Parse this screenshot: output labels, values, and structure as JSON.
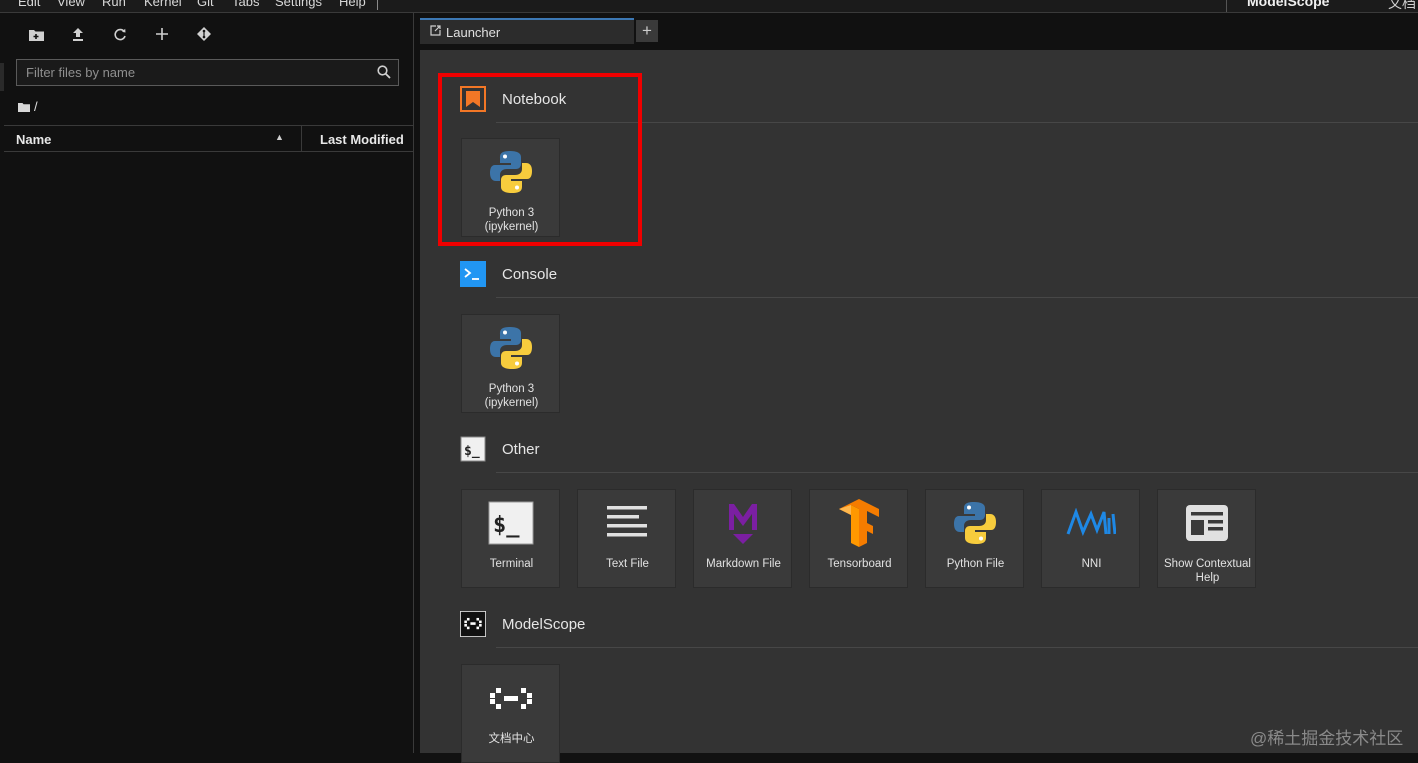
{
  "menubar": {
    "items": [
      "Edit",
      "View",
      "Run",
      "Kernel",
      "Git",
      "Tabs",
      "Settings",
      "Help"
    ],
    "brand": "ModelScope",
    "brand_doc": "文档"
  },
  "filebrowser": {
    "toolbar_icons": [
      "new-folder-icon",
      "upload-icon",
      "refresh-icon",
      "plus-icon",
      "git-clone-icon"
    ],
    "filter_placeholder": "Filter files by name",
    "breadcrumb": "/",
    "columns": {
      "name": "Name",
      "modified": "Last Modified"
    }
  },
  "tabs": {
    "active": "Launcher",
    "add": "+"
  },
  "launcher": {
    "sections": {
      "notebook": {
        "title": "Notebook",
        "items": [
          {
            "label_line1": "Python 3",
            "label_line2": "(ipykernel)"
          }
        ]
      },
      "console": {
        "title": "Console",
        "items": [
          {
            "label_line1": "Python 3",
            "label_line2": "(ipykernel)"
          }
        ]
      },
      "other": {
        "title": "Other",
        "items": [
          {
            "label": "Terminal"
          },
          {
            "label": "Text File"
          },
          {
            "label": "Markdown File"
          },
          {
            "label": "Tensorboard"
          },
          {
            "label": "Python File"
          },
          {
            "label": "NNI"
          },
          {
            "label_line1": "Show Contextual",
            "label_line2": "Help"
          }
        ]
      },
      "modelscope": {
        "title": "ModelScope",
        "items": [
          {
            "label": "文档中心"
          }
        ]
      }
    }
  },
  "colors": {
    "highlight": "#f00000",
    "tab_accent": "#3c78b4",
    "notebook_icon": "#f37726",
    "console_icon": "#2196f3"
  },
  "watermark": "@稀土掘金技术社区"
}
